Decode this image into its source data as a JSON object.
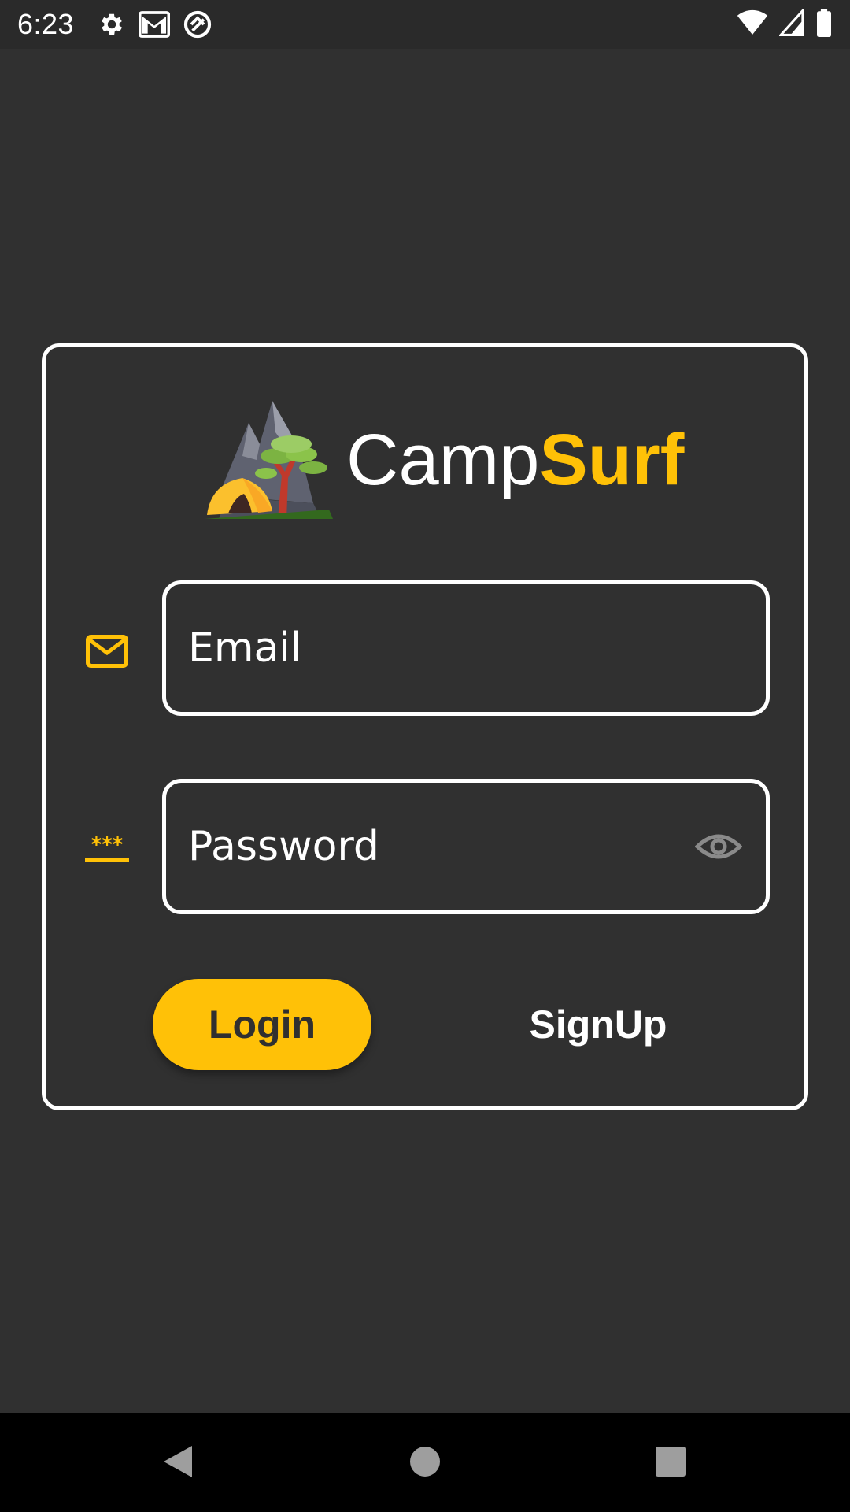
{
  "status_bar": {
    "time": "6:23",
    "icons": [
      "settings-icon",
      "gmail-icon",
      "app-icon",
      "wifi-icon",
      "signal-icon",
      "battery-icon"
    ]
  },
  "app": {
    "brand_part1": "Camp",
    "brand_part2": "Surf",
    "accent_color": "#ffc107",
    "background_color": "#303030"
  },
  "form": {
    "email_placeholder": "Email",
    "email_value": "",
    "password_placeholder": "Password",
    "password_value": "",
    "email_icon": "mail-icon",
    "password_icon": "password-icon",
    "visibility_icon": "eye-icon"
  },
  "buttons": {
    "login_label": "Login",
    "signup_label": "SignUp"
  },
  "nav_bar": {
    "icons": [
      "back-icon",
      "home-icon",
      "recents-icon"
    ]
  }
}
